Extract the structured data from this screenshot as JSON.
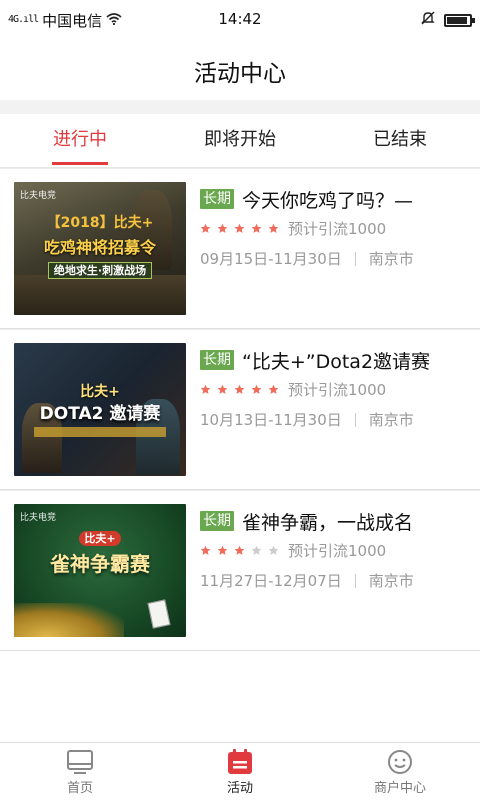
{
  "status_bar": {
    "signal": "4G.ıll",
    "carrier": "中国电信",
    "time": "14:42",
    "battery_level": 0.9
  },
  "page_title": "活动中心",
  "tabs": [
    {
      "label": "进行中",
      "active": true
    },
    {
      "label": "即将开始",
      "active": false
    },
    {
      "label": "已结束",
      "active": false
    }
  ],
  "activities": [
    {
      "tag": "长期",
      "title": "今天你吃鸡了吗？—",
      "rating": 5,
      "traffic": "预计引流1000",
      "date_range": "09月15日-11月30日",
      "city": "南京市",
      "thumb_brand": "比夫电竞",
      "thumb_lines": [
        "【2018】比夫+",
        "吃鸡神将招募令",
        "绝地求生·刺激战场"
      ]
    },
    {
      "tag": "长期",
      "title": "“比夫+”Dota2邀请赛",
      "rating": 5,
      "traffic": "预计引流1000",
      "date_range": "10月13日-11月30日",
      "city": "南京市",
      "thumb_brand": "",
      "thumb_lines": [
        "比夫+",
        "DOTA2 邀请赛"
      ]
    },
    {
      "tag": "长期",
      "title": "雀神争霸，一战成名",
      "rating": 3,
      "traffic": "预计引流1000",
      "date_range": "11月27日-12月07日",
      "city": "南京市",
      "thumb_brand": "比夫电竞",
      "thumb_lines": [
        "比夫+",
        "雀神争霸赛"
      ]
    }
  ],
  "bottom_nav": [
    {
      "label": "首页",
      "icon": "home-monitor-icon",
      "active": false
    },
    {
      "label": "活动",
      "icon": "calendar-icon",
      "active": true
    },
    {
      "label": "商户中心",
      "icon": "smiley-icon",
      "active": false
    }
  ],
  "colors": {
    "accent": "#e0393e",
    "tag_green": "#6aa84f",
    "star_filled": "#ef6b5a",
    "star_empty": "#cccccc"
  }
}
